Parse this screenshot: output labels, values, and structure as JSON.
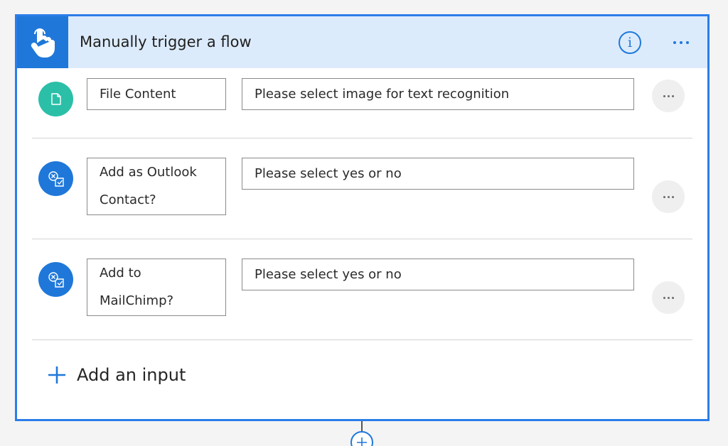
{
  "trigger": {
    "title": "Manually trigger a flow",
    "icon": "touch-hand-icon",
    "info_icon": "info-icon",
    "info_glyph": "i",
    "more_icon": "more-icon"
  },
  "inputs": [
    {
      "type": "file",
      "icon": "file-icon",
      "label": "File Content",
      "placeholder": "Please select image for text recognition"
    },
    {
      "type": "boolean",
      "icon": "yes-no-icon",
      "label": "Add as Outlook Contact?",
      "placeholder": "Please select yes or no"
    },
    {
      "type": "boolean",
      "icon": "yes-no-icon",
      "label": "Add to MailChimp?",
      "placeholder": "Please select yes or no"
    }
  ],
  "add_input": {
    "label": "Add an input",
    "icon": "plus-icon"
  },
  "add_step": {
    "icon": "plus-circle-icon"
  },
  "colors": {
    "accent": "#1f78d9",
    "header_bg": "#dcebfc",
    "file_icon_bg": "#2bbfa8",
    "card_border": "#2b7de9"
  }
}
